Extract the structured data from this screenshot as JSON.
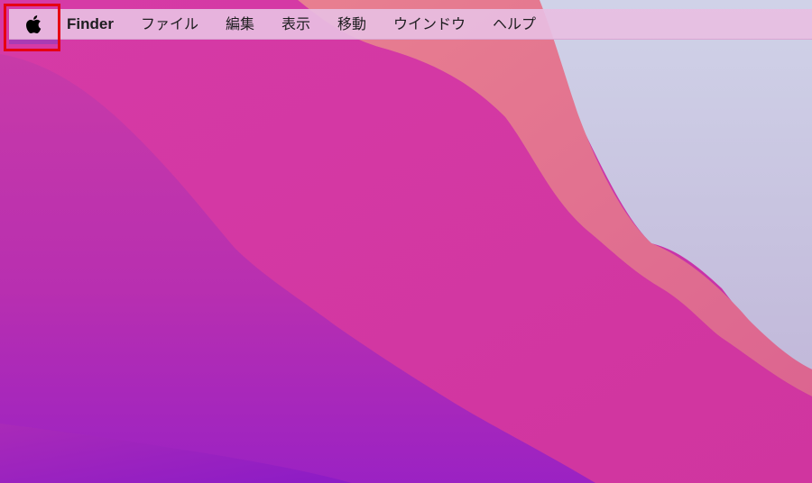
{
  "menubar": {
    "apple_icon": "apple-logo-icon",
    "app_name": "Finder",
    "items": [
      {
        "label": "ファイル"
      },
      {
        "label": "編集"
      },
      {
        "label": "表示"
      },
      {
        "label": "移動"
      },
      {
        "label": "ウインドウ"
      },
      {
        "label": "ヘルプ"
      }
    ]
  },
  "colors": {
    "highlight_box": "#e60012",
    "menubar_bg": "#e8bee2",
    "wallpaper_magenta": "#cf2fa6",
    "wallpaper_purple": "#9b1ec6",
    "wallpaper_coral": "#de6f8c",
    "wallpaper_lavender": "#c9c7e2"
  }
}
